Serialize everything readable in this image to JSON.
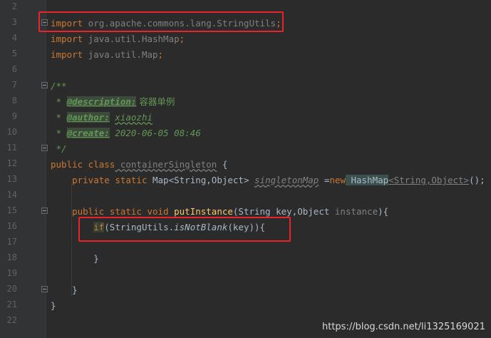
{
  "line_numbers": [
    "2",
    "3",
    "4",
    "5",
    "6",
    "7",
    "8",
    "9",
    "10",
    "11",
    "12",
    "13",
    "14",
    "15",
    "16",
    "17",
    "18",
    "19",
    "20",
    "21",
    "22"
  ],
  "code": {
    "l3": {
      "kw": "import",
      "rest": " org.apache.commons.lang.StringUtils",
      "semi": ";"
    },
    "l4": {
      "kw": "import",
      "rest": " java.util.HashMap",
      "semi": ";"
    },
    "l5": {
      "kw": "import",
      "rest": " java.util.Map",
      "semi": ";"
    },
    "l7": "/**",
    "l8": {
      "star": " * ",
      "tag": "@description:",
      "text": " 容器单例"
    },
    "l9": {
      "star": " * ",
      "tag": "@author:",
      "text": " ",
      "val": "xiaozhi"
    },
    "l10": {
      "star": " * ",
      "tag": "@create:",
      "text": " 2020-06-05 08:46"
    },
    "l11": " */",
    "l12": {
      "kw1": "public",
      "kw2": " class",
      "name": " containerSingleton",
      "rest": " {"
    },
    "l13": {
      "indent": "    ",
      "kw1": "private",
      "kw2": " static",
      "t1": " Map",
      "g1": "<String,Object>",
      "sp": " ",
      "field": "singletonMap",
      "eq": " =",
      "kw3": "new",
      "t2": " HashMap",
      "g2": "<String,Object>",
      "end": "();"
    },
    "l15": {
      "indent": "    ",
      "kw1": "public",
      "kw2": " static",
      "kw3": " void",
      "name": " putInstance",
      "p1": "(String key,Object ",
      "p2": "instance",
      "p3": "){"
    },
    "l16": {
      "indent": "        ",
      "kw": "if",
      "a": "(StringUtils.",
      "m": "isNotBlank",
      "b": "(key)){"
    },
    "l18": "        }",
    "l20": "    }",
    "l21": "}"
  },
  "watermark": "https://blog.csdn.net/li1325169021"
}
